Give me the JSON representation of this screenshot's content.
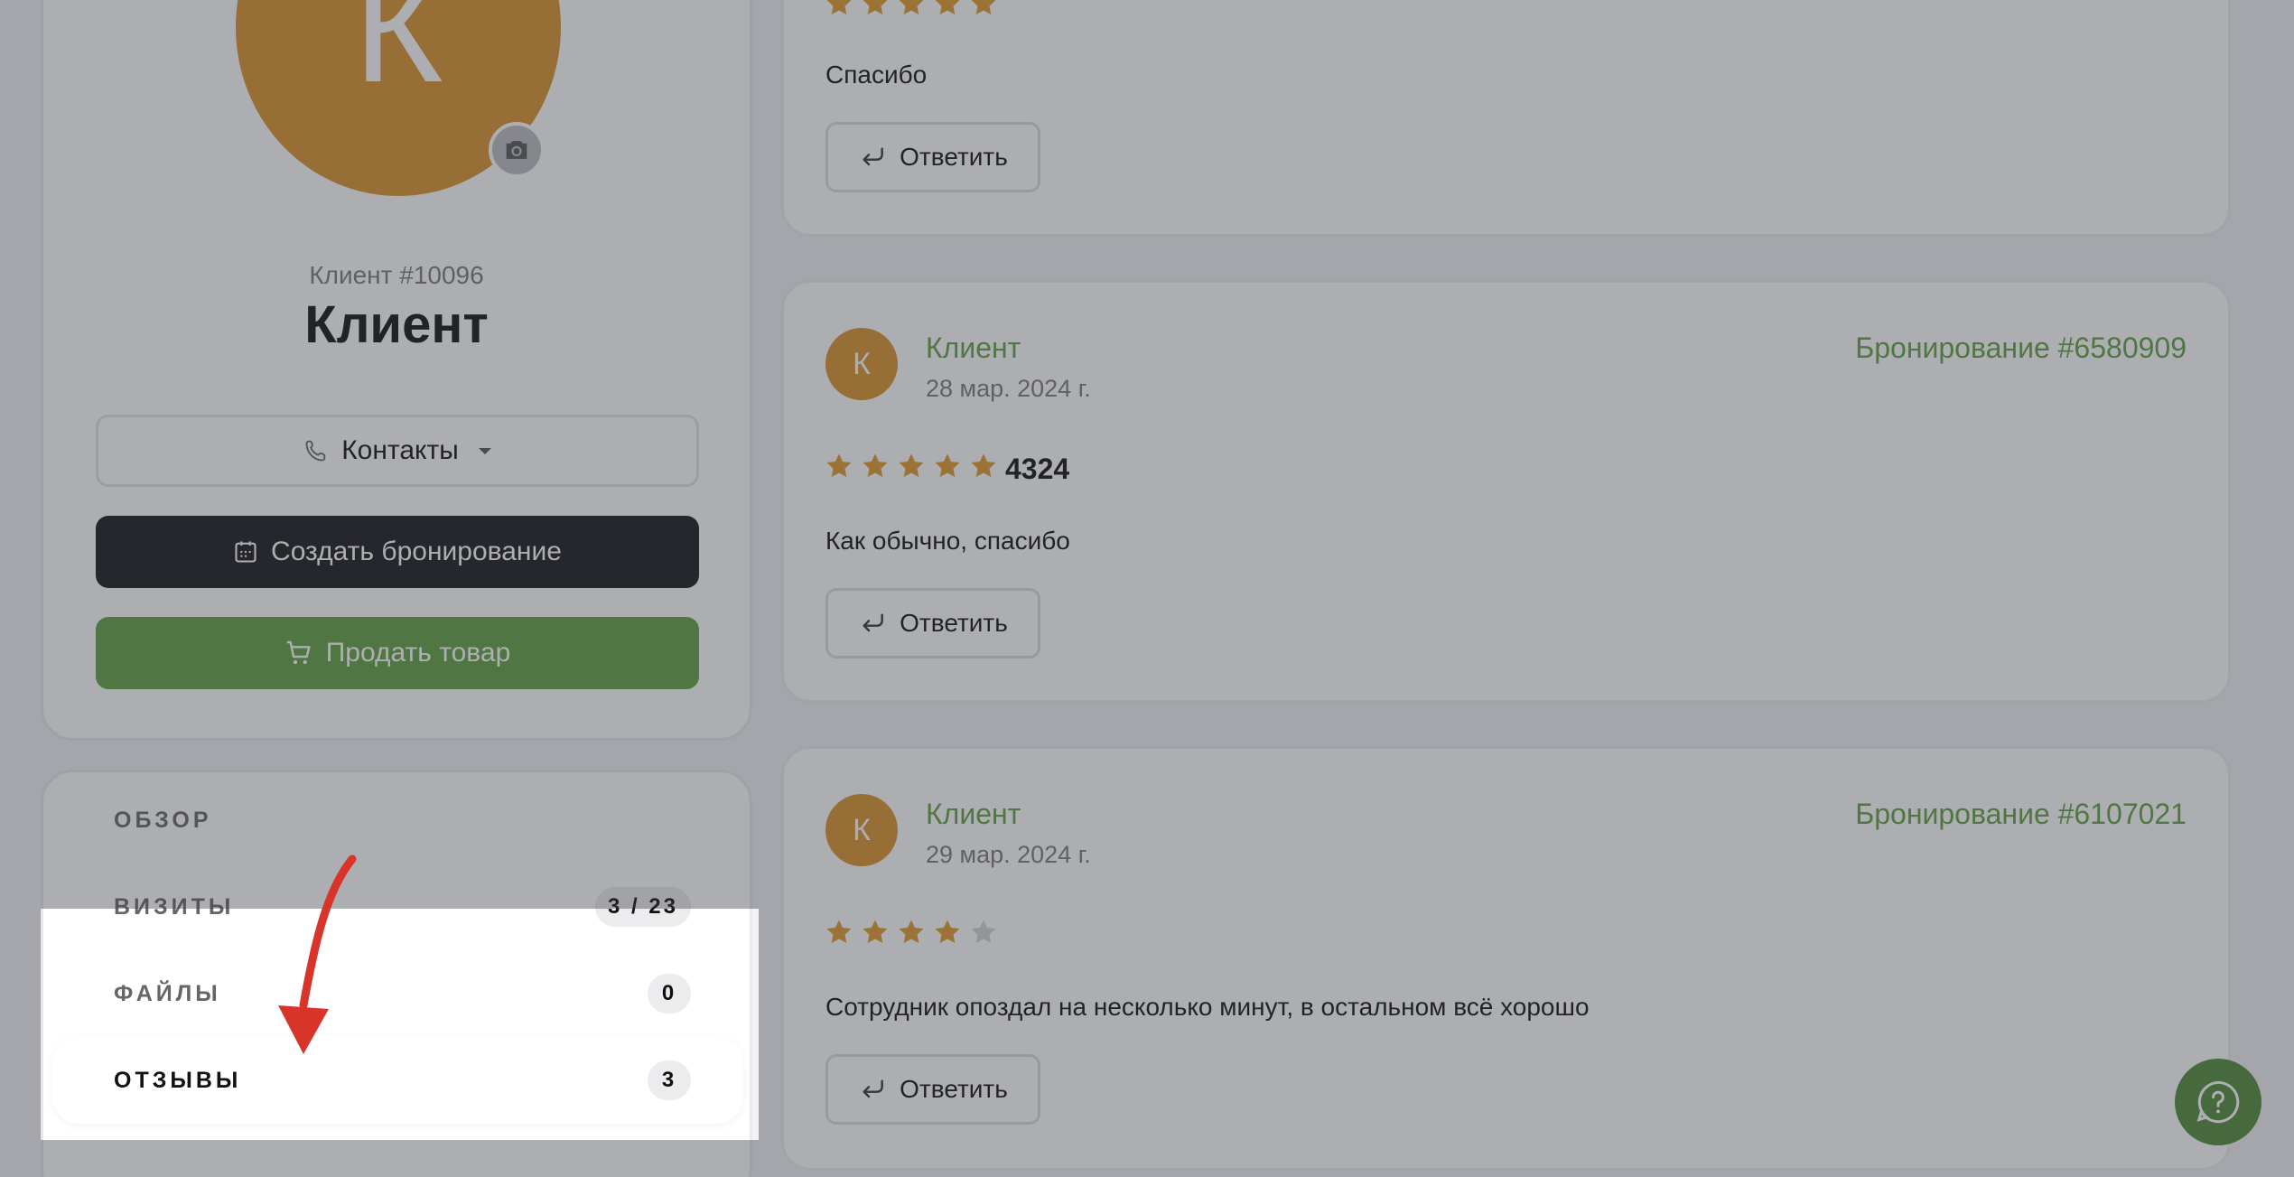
{
  "profile": {
    "avatar_letter": "К",
    "client_id": "Клиент #10096",
    "name": "Клиент",
    "contacts_label": "Контакты",
    "create_booking_label": "Создать бронирование",
    "sell_label": "Продать товар"
  },
  "nav": {
    "items": [
      {
        "label": "ОБЗОР",
        "badge": ""
      },
      {
        "label": "ВИЗИТЫ",
        "badge": "3 / 23"
      },
      {
        "label": "ФАЙЛЫ",
        "badge": "0"
      },
      {
        "label": "ОТЗЫВЫ",
        "badge": "3"
      }
    ],
    "active": "ОТЗЫВЫ"
  },
  "reviews": [
    {
      "rating": 5,
      "text": "Спасибо",
      "reply_label": "Ответить"
    },
    {
      "avatar_letter": "К",
      "author": "Клиент",
      "date": "28 мар. 2024 г.",
      "booking": "Бронирование #6580909",
      "rating": 5,
      "score": "4324",
      "text": "Как обычно, спасибо",
      "reply_label": "Ответить"
    },
    {
      "avatar_letter": "К",
      "author": "Клиент",
      "date": "29 мар. 2024 г.",
      "booking": "Бронирование #6107021",
      "rating": 4,
      "text": "Сотрудник опоздал на несколько минут, в остальном всё хорошо",
      "reply_label": "Ответить"
    }
  ],
  "colors": {
    "accent_green": "#5fa043",
    "avatar_orange": "#d9912a",
    "star_gold": "#e29a2c",
    "star_empty": "#d5d5d8",
    "annotation_red": "#d8342a"
  },
  "icons": [
    "camera-icon",
    "phone-icon",
    "calendar-icon",
    "cart-icon",
    "reply-icon",
    "star-icon",
    "help-icon"
  ]
}
